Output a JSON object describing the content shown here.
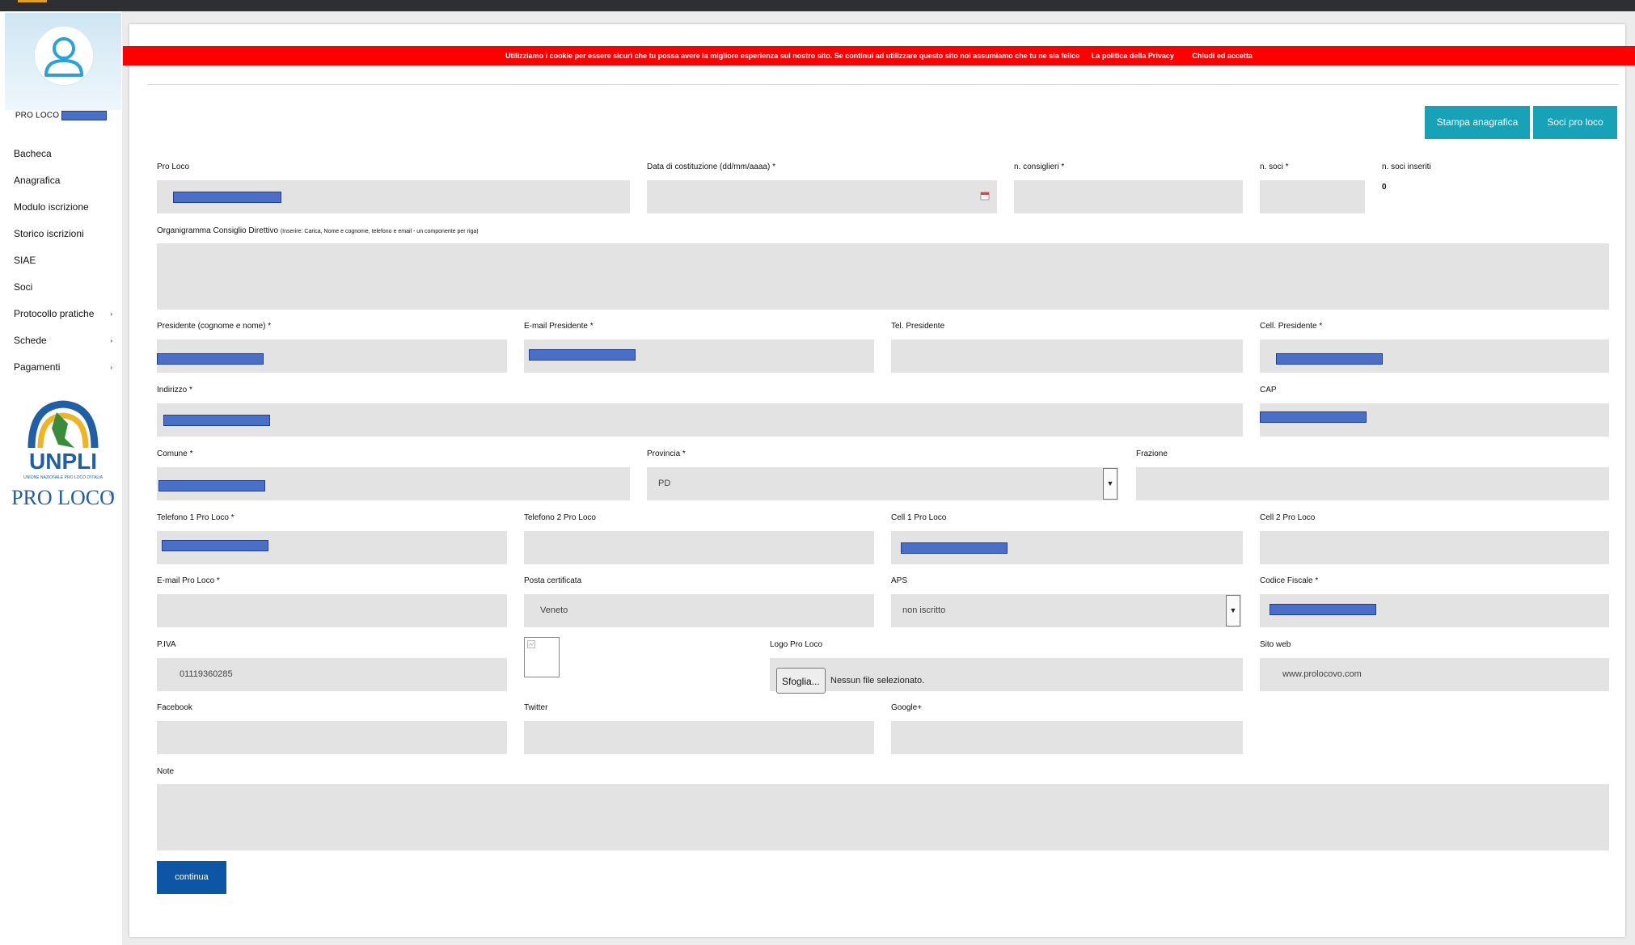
{
  "sidebar": {
    "user_label": "PRO LOCO",
    "items": [
      {
        "label": "Bacheca",
        "arrow": ""
      },
      {
        "label": "Anagrafica",
        "arrow": ""
      },
      {
        "label": "Modulo iscrizione",
        "arrow": ""
      },
      {
        "label": "Storico iscrizioni",
        "arrow": ""
      },
      {
        "label": "SIAE",
        "arrow": ""
      },
      {
        "label": "Soci",
        "arrow": ""
      },
      {
        "label": "Protocollo pratiche",
        "arrow": "›"
      },
      {
        "label": "Schede",
        "arrow": "›"
      },
      {
        "label": "Pagamenti",
        "arrow": "›"
      }
    ],
    "logo": {
      "brand": "UNPLI",
      "tagline": "UNIONE NAZIONALE PRO LOCO D'ITALIA",
      "text": "PRO LOCO",
      "reg": "®"
    }
  },
  "cookie": {
    "message": "Utilizziamo i cookie per essere sicuri che tu possa avere la migliore esperienza sul nostro sito. Se continui ad utilizzare questo sito noi assumiamo che tu ne sia felice",
    "privacy_link": "La politica della Privacy",
    "accept": "Chiudi ed accetta"
  },
  "buttons": {
    "stampa": "Stampa anagrafica",
    "soci": "Soci pro loco",
    "continua": "continua",
    "sfoglia": "Sfoglia..."
  },
  "labels": {
    "pro_loco": "Pro Loco",
    "data_costituzione": "Data di costituzione (dd/mm/aaaa) *",
    "n_consiglieri": "n. consiglieri *",
    "n_soci": "n. soci *",
    "n_soci_inseriti": "n. soci inseriti",
    "organigramma": "Organigramma Consiglio Direttivo",
    "organigramma_hint": "(Inserire: Carica, Nome e cognome, telefono e email - un componente per riga)",
    "presidente": "Presidente (cognome e nome) *",
    "email_presidente": "E-mail Presidente *",
    "tel_presidente": "Tel. Presidente",
    "cell_presidente": "Cell. Presidente *",
    "indirizzo": "Indirizzo *",
    "cap": "CAP",
    "comune": "Comune *",
    "provincia": "Provincia *",
    "frazione": "Frazione",
    "telefono1": "Telefono 1 Pro Loco *",
    "telefono2": "Telefono 2 Pro Loco",
    "cell1": "Cell 1 Pro Loco",
    "cell2": "Cell 2 Pro Loco",
    "email_proloco": "E-mail Pro Loco *",
    "posta_certificata": "Posta certificata",
    "aps": "APS",
    "codice_fiscale": "Codice Fiscale *",
    "piva": "P.IVA",
    "logo": "Logo Pro Loco",
    "sito_web": "Sito web",
    "facebook": "Facebook",
    "twitter": "Twitter",
    "google": "Google+",
    "note": "Note"
  },
  "values": {
    "n_soci_inseriti": "0",
    "provincia": "PD",
    "posta_certificata": "Veneto",
    "aps": "non iscritto",
    "piva": "01119360285",
    "sito_web": "www.prolocovo.com",
    "file_status": "Nessun file selezionato."
  },
  "colors": {
    "accent": "#17a2b8",
    "primary": "#0d56a6",
    "cookie_bar": "#ff0000",
    "field_bg": "#e3e3e3",
    "redaction": "#4a6fc9"
  },
  "icons": [
    "user-icon",
    "calendar-icon",
    "chevron-down-icon",
    "image-placeholder-icon"
  ]
}
